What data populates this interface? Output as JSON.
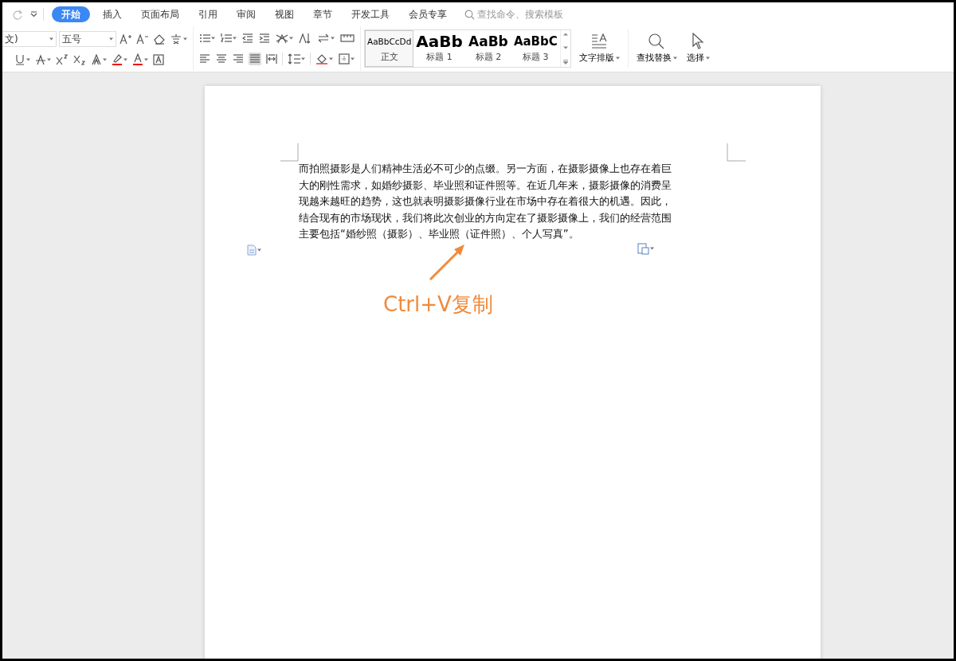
{
  "quick_access": {
    "redo_disabled": true
  },
  "tabs": [
    {
      "label": "开始",
      "selected": true
    },
    {
      "label": "插入",
      "selected": false
    },
    {
      "label": "页面布局",
      "selected": false
    },
    {
      "label": "引用",
      "selected": false
    },
    {
      "label": "审阅",
      "selected": false
    },
    {
      "label": "视图",
      "selected": false
    },
    {
      "label": "章节",
      "selected": false
    },
    {
      "label": "开发工具",
      "selected": false
    },
    {
      "label": "会员专享",
      "selected": false
    }
  ],
  "search": {
    "placeholder": "查找命令、搜索模板"
  },
  "font": {
    "name": "文)",
    "size": "五号"
  },
  "alignment": [
    {
      "selected": false
    },
    {
      "selected": false
    },
    {
      "selected": false
    },
    {
      "selected": true
    },
    {
      "selected": false
    }
  ],
  "styles": [
    {
      "sample": "AaBbCcDd",
      "label": "正文",
      "kind": "body",
      "selected": true
    },
    {
      "sample": "AaBb",
      "label": "标题 1",
      "kind": "h1",
      "selected": false
    },
    {
      "sample": "AaBb",
      "label": "标题 2",
      "kind": "h2",
      "selected": false
    },
    {
      "sample": "AaBbC",
      "label": "标题 3",
      "kind": "h3",
      "selected": false
    }
  ],
  "big_buttons": [
    {
      "label": "文字排版",
      "kind": "layout"
    },
    {
      "label": "查找替换",
      "kind": "find"
    },
    {
      "label": "选择",
      "kind": "select"
    }
  ],
  "document": {
    "paragraph": "而拍照摄影是人们精神生活必不可少的点缀。另一方面，在摄影摄像上也存在着巨大的刚性需求，如婚纱摄影、毕业照和证件照等。在近几年来，摄影摄像的消费呈现越来越旺的趋势，这也就表明摄影摄像行业在市场中存在着很大的机遇。因此，结合现有的市场现状，我们将此次创业的方向定在了摄影摄像上，我们的经营范围主要包括“婚纱照（摄影）、毕业照（证件照）、个人写真”。"
  },
  "annotation": {
    "text": "Ctrl+V复制"
  }
}
